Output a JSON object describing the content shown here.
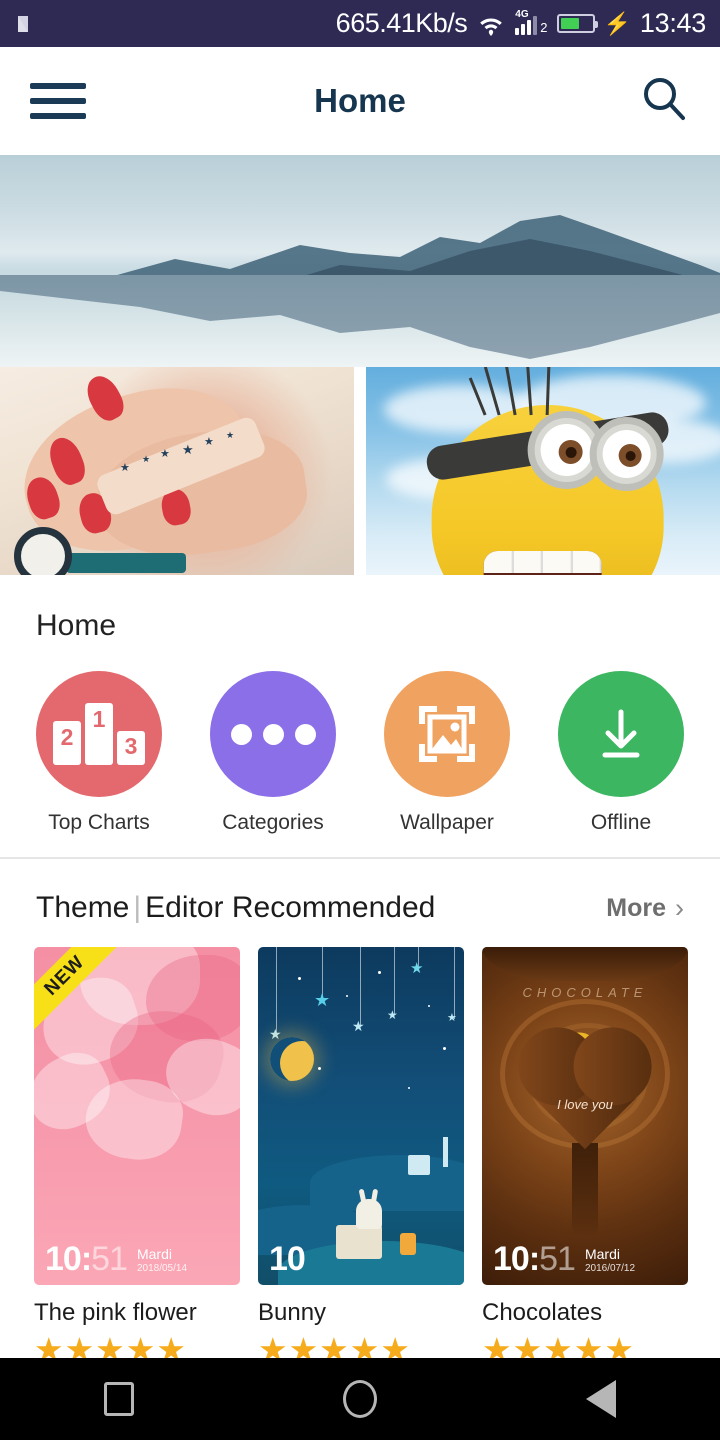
{
  "status_bar": {
    "logo_icon": "nougat-n-logo",
    "network_speed": "665.41Kb/s",
    "wifi_icon": "wifi-icon",
    "signal_tech": "4G",
    "sim_slot": "2",
    "battery_icon": "battery-icon",
    "charging_icon": "charging-bolt-icon",
    "time": "13:43",
    "background_color": "#2e2a54"
  },
  "app_bar": {
    "menu_icon": "hamburger-menu-icon",
    "title": "Home",
    "search_icon": "search-icon",
    "title_color": "#16354f"
  },
  "hero_banner": {
    "alt": "mountain range reflected in a still lake"
  },
  "tiles": [
    {
      "alt": "hands with red nail polish and star tattoo"
    },
    {
      "alt": "minion character with goggles against blue sky"
    }
  ],
  "home_section": {
    "heading": "Home",
    "shortcuts": [
      {
        "label": "Top Charts",
        "icon": "podium-icon",
        "color": "#e3696e",
        "podium": [
          "2",
          "1",
          "3"
        ]
      },
      {
        "label": "Categories",
        "icon": "ellipsis-icon",
        "color": "#8b6fe8"
      },
      {
        "label": "Wallpaper",
        "icon": "image-icon",
        "color": "#f0a261"
      },
      {
        "label": "Offline",
        "icon": "download-icon",
        "color": "#3db662"
      }
    ]
  },
  "theme_section": {
    "title_primary": "Theme",
    "title_separator": "|",
    "title_secondary": "Editor Recommended",
    "more_label": "More",
    "more_chevron_icon": "chevron-right-icon",
    "cards": [
      {
        "title": "The pink flower",
        "badge": "NEW",
        "rating": 5,
        "stars": "★★★★★",
        "lock_time": "10:",
        "lock_time_dim": "51",
        "lock_day": "Mardi",
        "lock_date": "2018/05/14"
      },
      {
        "title": "Bunny",
        "badge": "",
        "rating": 5,
        "stars": "★★★★★",
        "lock_time": "10",
        "lock_time_dim": "",
        "lock_day": "",
        "lock_date": ""
      },
      {
        "title": "Chocolates",
        "badge": "",
        "rating": 5,
        "stars": "★★★★★",
        "lock_time": "10:",
        "lock_time_dim": "51",
        "lock_day": "Mardi",
        "lock_date": "2016/07/12",
        "art_title": "CHOCOLATE",
        "art_caption": "I love you"
      }
    ]
  },
  "nav_bar": {
    "recents_icon": "recents-square-icon",
    "home_icon": "home-circle-icon",
    "back_icon": "back-triangle-icon"
  }
}
